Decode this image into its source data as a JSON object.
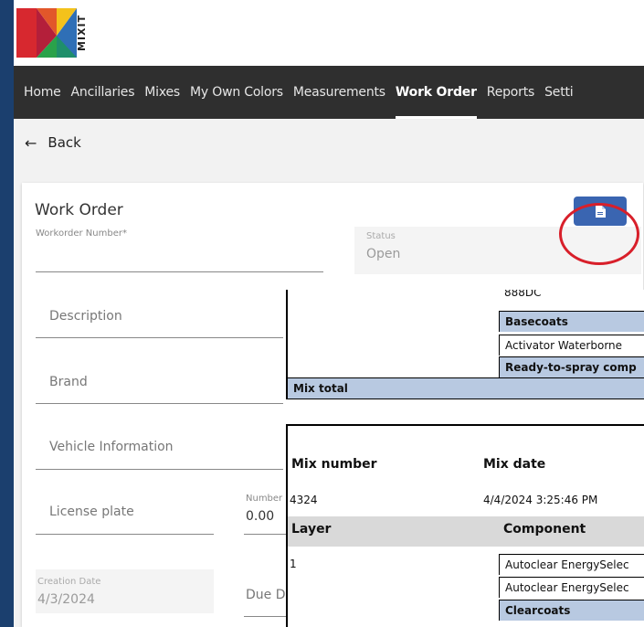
{
  "brand": {
    "logo_text": "MIXIT",
    "colors": {
      "red": "#d7282f",
      "green": "#2aa24a",
      "blue": "#2f6fb6",
      "yellow": "#f4c21b"
    }
  },
  "nav": {
    "items": [
      {
        "label": "Home"
      },
      {
        "label": "Ancillaries"
      },
      {
        "label": "Mixes"
      },
      {
        "label": "My Own Colors"
      },
      {
        "label": "Measurements"
      },
      {
        "label": "Work Order",
        "active": true
      },
      {
        "label": "Reports"
      },
      {
        "label": "Setti"
      }
    ]
  },
  "back": {
    "icon": "arrow-left-icon",
    "label": "Back"
  },
  "form": {
    "title": "Work Order",
    "action_button_icon": "document-icon",
    "workorder_number": {
      "label": "Workorder Number*",
      "value": ""
    },
    "status": {
      "label": "Status",
      "value": "Open"
    },
    "description": {
      "placeholder": "Description"
    },
    "brand": {
      "placeholder": "Brand"
    },
    "vehicle": {
      "placeholder": "Vehicle Information"
    },
    "license": {
      "placeholder": "License plate"
    },
    "number": {
      "label": "Number",
      "value": "0.00"
    },
    "creation_date": {
      "label": "Creation Date",
      "value": "4/3/2024"
    },
    "due_date": {
      "placeholder": "Due D"
    }
  },
  "report": {
    "upper_rows": [
      {
        "text": "888DC",
        "style": "plain"
      },
      {
        "text": "Basecoats",
        "style": "blue"
      },
      {
        "text": "Activator Waterborne",
        "style": "plain"
      },
      {
        "text": "Ready-to-spray comp",
        "style": "blue"
      }
    ],
    "mix_total": "Mix total",
    "mix_number_label": "Mix number",
    "mix_date_label": "Mix date",
    "mix_number": "4324",
    "mix_date": "4/4/2024 3:25:46 PM",
    "layer_label": "Layer",
    "component_label": "Component",
    "layer_value": "1",
    "components": [
      {
        "text": "Autoclear EnergySelec",
        "style": "plain"
      },
      {
        "text": "Autoclear EnergySelec",
        "style": "plain"
      },
      {
        "text": "Clearcoats",
        "style": "blue"
      }
    ]
  }
}
